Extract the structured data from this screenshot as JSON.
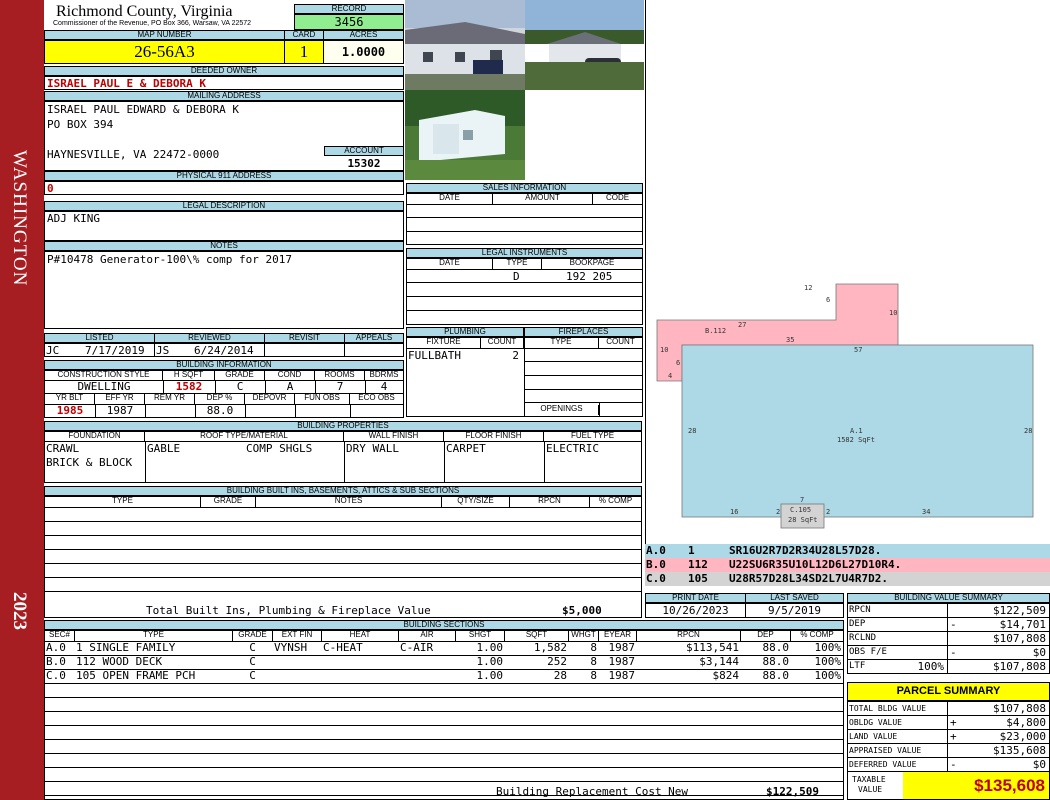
{
  "sidebar": {
    "district": "WASHINGTON",
    "year": "2023"
  },
  "header": {
    "county": "Richmond County, Virginia",
    "commissioner": "Commissioner of the Revenue, PO Box 366, Warsaw, VA 22572",
    "record_label": "RECORD",
    "record": "3456",
    "map_label": "MAP NUMBER",
    "map_number": "26-56A3",
    "card_label": "CARD",
    "card": "1",
    "acres_label": "ACRES",
    "acres": "1.0000"
  },
  "owner": {
    "label": "DEEDED OWNER",
    "name": "ISRAEL PAUL E & DEBORA K"
  },
  "mailing": {
    "label": "MAILING ADDRESS",
    "line1": "ISRAEL PAUL EDWARD & DEBORA K",
    "line2": "PO BOX 394",
    "line3": "HAYNESVILLE, VA 22472-0000",
    "account_label": "ACCOUNT",
    "account": "15302"
  },
  "physical": {
    "label": "PHYSICAL 911 ADDRESS",
    "value": "0"
  },
  "legal": {
    "label": "LEGAL DESCRIPTION",
    "value": "ADJ KING"
  },
  "notes": {
    "label": "NOTES",
    "value": "P#10478 Generator-100\\% comp for 2017"
  },
  "sales": {
    "label": "SALES INFORMATION",
    "cols": [
      "DATE",
      "AMOUNT",
      "CODE"
    ]
  },
  "instruments": {
    "label": "LEGAL INSTRUMENTS",
    "cols": [
      "DATE",
      "TYPE",
      "BOOKPAGE"
    ],
    "type": "D",
    "bookpage": "192 205"
  },
  "plumbing": {
    "label": "PLUMBING",
    "fixture_col": "FIXTURE",
    "count_col": "COUNT",
    "fixture": "FULLBATH",
    "count": "2"
  },
  "fireplaces": {
    "label": "FIREPLACES",
    "type_col": "TYPE",
    "count_col": "COUNT",
    "openings": "OPENINGS"
  },
  "listing": {
    "listed_label": "LISTED",
    "reviewed_label": "REVIEWED",
    "revisit_label": "REVISIT",
    "appeals_label": "APPEALS",
    "listed_by": "JC",
    "listed_date": "7/17/2019",
    "reviewed_by": "JS",
    "reviewed_date": "6/24/2014"
  },
  "building_info": {
    "label": "BUILDING INFORMATION",
    "cols": [
      "CONSTRUCTION STYLE",
      "H SQFT",
      "GRADE",
      "COND",
      "ROOMS",
      "BDRMS"
    ],
    "style": "DWELLING",
    "hsqft": "1582",
    "grade": "C",
    "cond": "A",
    "rooms": "7",
    "bdrms": "4",
    "cols2": [
      "YR BLT",
      "EFF YR",
      "REM YR",
      "DEP %",
      "DEPOVR",
      "FUN OBS",
      "ECO OBS"
    ],
    "yr_blt": "1985",
    "eff_yr": "1987",
    "dep": "88.0"
  },
  "properties": {
    "label": "BUILDING PROPERTIES",
    "cols": [
      "FOUNDATION",
      "ROOF TYPE/MATERIAL",
      "WALL FINISH",
      "FLOOR FINISH",
      "FUEL TYPE"
    ],
    "foundation1": "CRAWL",
    "foundation2": "BRICK & BLOCK",
    "roof_type": "GABLE",
    "roof_material": "COMP SHGLS",
    "wall": "DRY WALL",
    "floor": "CARPET",
    "fuel": "ELECTRIC"
  },
  "builtins": {
    "label": "BUILDING BUILT INS, BASEMENTS, ATTICS & SUB SECTIONS",
    "cols": [
      "TYPE",
      "GRADE",
      "NOTES",
      "QTY/SIZE",
      "RPCN",
      "% COMP"
    ],
    "total_label": "Total Built Ins, Plumbing & Fireplace Value",
    "total": "$5,000"
  },
  "sections": {
    "label": "BUILDING SECTIONS",
    "cols": [
      "SEC#",
      "TYPE",
      "GRADE",
      "EXT FIN",
      "HEAT",
      "AIR",
      "SHGT",
      "SQFT",
      "WHGT",
      "EYEAR",
      "RPCN",
      "DEP",
      "% COMP"
    ],
    "rows": [
      [
        "A.0",
        "1 SINGLE FAMILY",
        "C",
        "VYNSH",
        "C-HEAT",
        "C-AIR",
        "1.00",
        "1,582",
        "8",
        "1987",
        "$113,541",
        "88.0",
        "100%"
      ],
      [
        "B.0",
        "112 WOOD DECK",
        "C",
        "",
        "",
        "",
        "1.00",
        "252",
        "8",
        "1987",
        "$3,144",
        "88.0",
        "100%"
      ],
      [
        "C.0",
        "105 OPEN FRAME PCH",
        "C",
        "",
        "",
        "",
        "1.00",
        "28",
        "8",
        "1987",
        "$824",
        "88.0",
        "100%"
      ]
    ],
    "replacement_label": "Building Replacement Cost New",
    "replacement": "$122,509"
  },
  "sketch": {
    "a_label": "A.1",
    "a_area": "1582 SqFt",
    "b_label": "B.112",
    "c_label": "C.105",
    "c_area": "28 SqFt",
    "dims": [
      "12",
      "6",
      "10",
      "27",
      "35",
      "10",
      "6",
      "4",
      "57",
      "28",
      "28",
      "7",
      "16",
      "2",
      "2",
      "34"
    ]
  },
  "vectors": [
    {
      "sec": "A.0",
      "code": "1",
      "vector": "SR16U2R7D2R34U28L57D28.",
      "color": "#add8e6"
    },
    {
      "sec": "B.0",
      "code": "112",
      "vector": "U22SU6R35U10L12D6L27D10R4.",
      "color": "#ffb6c1"
    },
    {
      "sec": "C.0",
      "code": "105",
      "vector": "U28R57D28L34SD2L7U4R7D2.",
      "color": "#d3d3d3"
    }
  ],
  "dates": {
    "print_label": "PRINT DATE",
    "print": "10/26/2023",
    "saved_label": "LAST SAVED",
    "saved": "9/5/2019"
  },
  "value_summary": {
    "label": "BUILDING VALUE SUMMARY",
    "rows": [
      {
        "name": "RPCN",
        "sign": "",
        "pct": "",
        "value": "$122,509"
      },
      {
        "name": "DEP",
        "sign": "-",
        "pct": "",
        "value": "$14,701"
      },
      {
        "name": "RCLND",
        "sign": "",
        "pct": "",
        "value": "$107,808"
      },
      {
        "name": "OBS F/E",
        "sign": "-",
        "pct": "",
        "value": "$0"
      },
      {
        "name": "LTF",
        "sign": "",
        "pct": "100%",
        "value": "$107,808"
      }
    ]
  },
  "parcel_summary": {
    "label": "PARCEL SUMMARY",
    "rows": [
      {
        "name": "TOTAL BLDG VALUE",
        "sign": "",
        "value": "$107,808"
      },
      {
        "name": "OBLDG VALUE",
        "sign": "+",
        "value": "$4,800"
      },
      {
        "name": "LAND VALUE",
        "sign": "+",
        "value": "$23,000"
      },
      {
        "name": "APPRAISED VALUE",
        "sign": "",
        "value": "$135,608"
      },
      {
        "name": "DEFERRED VALUE",
        "sign": "-",
        "value": "$0"
      }
    ],
    "taxable_label1": "TAXABLE",
    "taxable_label2": "VALUE",
    "taxable": "$135,608"
  }
}
